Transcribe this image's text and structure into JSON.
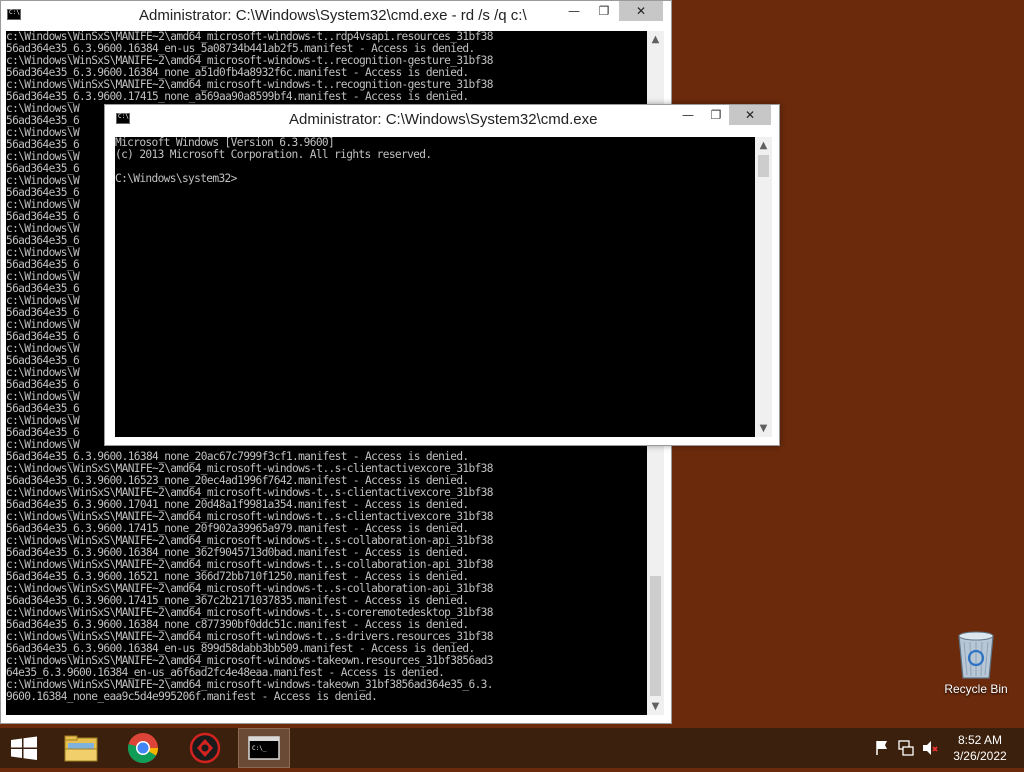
{
  "back_window": {
    "title": "Administrator: C:\\Windows\\System32\\cmd.exe - rd  /s /q c:\\",
    "controls": {
      "minimize": "—",
      "restore": "❐",
      "close": "✕"
    },
    "lines": [
      "c:\\Windows\\WinSxS\\MANIFE~2\\amd64_microsoft-windows-t..rdp4vsapi.resources_31bf38",
      "56ad364e35_6.3.9600.16384_en-us_5a08734b441ab2f5.manifest - Access is denied.",
      "c:\\Windows\\WinSxS\\MANIFE~2\\amd64_microsoft-windows-t..recognition-gesture_31bf38",
      "56ad364e35_6.3.9600.16384_none_a51d0fb4a8932f6c.manifest - Access is denied.",
      "c:\\Windows\\WinSxS\\MANIFE~2\\amd64_microsoft-windows-t..recognition-gesture_31bf38",
      "56ad364e35_6.3.9600.17415_none_a569aa90a8599bf4.manifest - Access is denied.",
      "c:\\Windows\\W",
      "56ad364e35_6",
      "c:\\Windows\\W",
      "56ad364e35_6",
      "c:\\Windows\\W",
      "56ad364e35_6",
      "c:\\Windows\\W",
      "56ad364e35_6",
      "c:\\Windows\\W",
      "56ad364e35_6",
      "c:\\Windows\\W",
      "56ad364e35_6",
      "c:\\Windows\\W",
      "56ad364e35_6",
      "c:\\Windows\\W",
      "56ad364e35_6",
      "c:\\Windows\\W",
      "56ad364e35_6",
      "c:\\Windows\\W",
      "56ad364e35_6",
      "c:\\Windows\\W",
      "56ad364e35_6",
      "c:\\Windows\\W",
      "56ad364e35_6",
      "c:\\Windows\\W",
      "56ad364e35_6",
      "c:\\Windows\\W",
      "56ad364e35_6",
      "c:\\Windows\\W",
      "56ad364e35_6.3.9600.16384_none_20ac67c7999f3cf1.manifest - Access is denied.",
      "c:\\Windows\\WinSxS\\MANIFE~2\\amd64_microsoft-windows-t..s-clientactivexcore_31bf38",
      "56ad364e35_6.3.9600.16523_none_20ec4ad1996f7642.manifest - Access is denied.",
      "c:\\Windows\\WinSxS\\MANIFE~2\\amd64_microsoft-windows-t..s-clientactivexcore_31bf38",
      "56ad364e35_6.3.9600.17041_none_20d48a1f9981a354.manifest - Access is denied.",
      "c:\\Windows\\WinSxS\\MANIFE~2\\amd64_microsoft-windows-t..s-clientactivexcore_31bf38",
      "56ad364e35_6.3.9600.17415_none_20f902a39965a979.manifest - Access is denied.",
      "c:\\Windows\\WinSxS\\MANIFE~2\\amd64_microsoft-windows-t..s-collaboration-api_31bf38",
      "56ad364e35_6.3.9600.16384_none_362f9045713d0bad.manifest - Access is denied.",
      "c:\\Windows\\WinSxS\\MANIFE~2\\amd64_microsoft-windows-t..s-collaboration-api_31bf38",
      "56ad364e35_6.3.9600.16521_none_366d72bb710f1250.manifest - Access is denied.",
      "c:\\Windows\\WinSxS\\MANIFE~2\\amd64_microsoft-windows-t..s-collaboration-api_31bf38",
      "56ad364e35_6.3.9600.17415_none_367c2b2171037835.manifest - Access is denied.",
      "c:\\Windows\\WinSxS\\MANIFE~2\\amd64_microsoft-windows-t..s-coreremotedesktop_31bf38",
      "56ad364e35_6.3.9600.16384_none_c877390bf0ddc51c.manifest - Access is denied.",
      "c:\\Windows\\WinSxS\\MANIFE~2\\amd64_microsoft-windows-t..s-drivers.resources_31bf38",
      "56ad364e35_6.3.9600.16384_en-us_899d58dabb3bb509.manifest - Access is denied.",
      "c:\\Windows\\WinSxS\\MANIFE~2\\amd64_microsoft-windows-takeown.resources_31bf3856ad3",
      "64e35_6.3.9600.16384_en-us_a6f6ad2fc4e48eaa.manifest - Access is denied.",
      "c:\\Windows\\WinSxS\\MANIFE~2\\amd64_microsoft-windows-takeown_31bf3856ad364e35_6.3.",
      "9600.16384_none_eaa9c5d4e995206f.manifest - Access is denied.",
      ""
    ]
  },
  "front_window": {
    "title": "Administrator: C:\\Windows\\System32\\cmd.exe",
    "controls": {
      "minimize": "—",
      "restore": "❐",
      "close": "✕"
    },
    "lines": [
      "Microsoft Windows [Version 6.3.9600]",
      "(c) 2013 Microsoft Corporation. All rights reserved.",
      "",
      "C:\\Windows\\system32>"
    ]
  },
  "desktop": {
    "recycle_bin_label": "Recycle Bin"
  },
  "taskbar": {
    "apps": [
      "start-button",
      "file-explorer",
      "chrome",
      "red-app",
      "command-prompt"
    ],
    "clock_time": "8:52 AM",
    "clock_date": "3/26/2022"
  },
  "colors": {
    "desktop": "#6b2a0c",
    "taskbar": "#3a200d",
    "console_bg": "#000000",
    "console_fg": "#c0c0c0"
  }
}
